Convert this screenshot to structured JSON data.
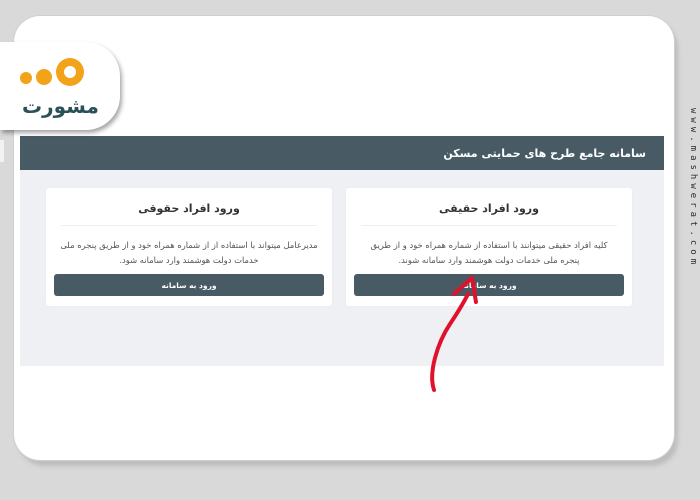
{
  "header": {
    "title": "سامانه جامع طرح های حمایتی مسکن"
  },
  "cards": {
    "real": {
      "title": "ورود افراد حقیقی",
      "description": "کلیه افراد حقیقی میتوانند با استفاده از شماره همراه خود و از طریق پنجره ملی خدمات دولت هوشمند وارد سامانه شوند.",
      "button_label": "ورود به سامانه"
    },
    "legal": {
      "title": "ورود افراد حقوقی",
      "description": "مدیرعامل میتواند با استفاده از از شماره همراه خود و از طریق پنجره ملی خدمات دولت هوشمند وارد سامانه شود.",
      "button_label": "ورود به سامانه"
    }
  },
  "branding": {
    "logo_text": "مشورت",
    "website": "www.mashwerat.com"
  },
  "colors": {
    "header_bg": "#485b64",
    "accent_orange": "#f2a319",
    "logo_teal": "#2a5158",
    "arrow_red": "#e0112b"
  },
  "icons": [
    "annotation-arrow-icon",
    "logo-dots-icon"
  ]
}
